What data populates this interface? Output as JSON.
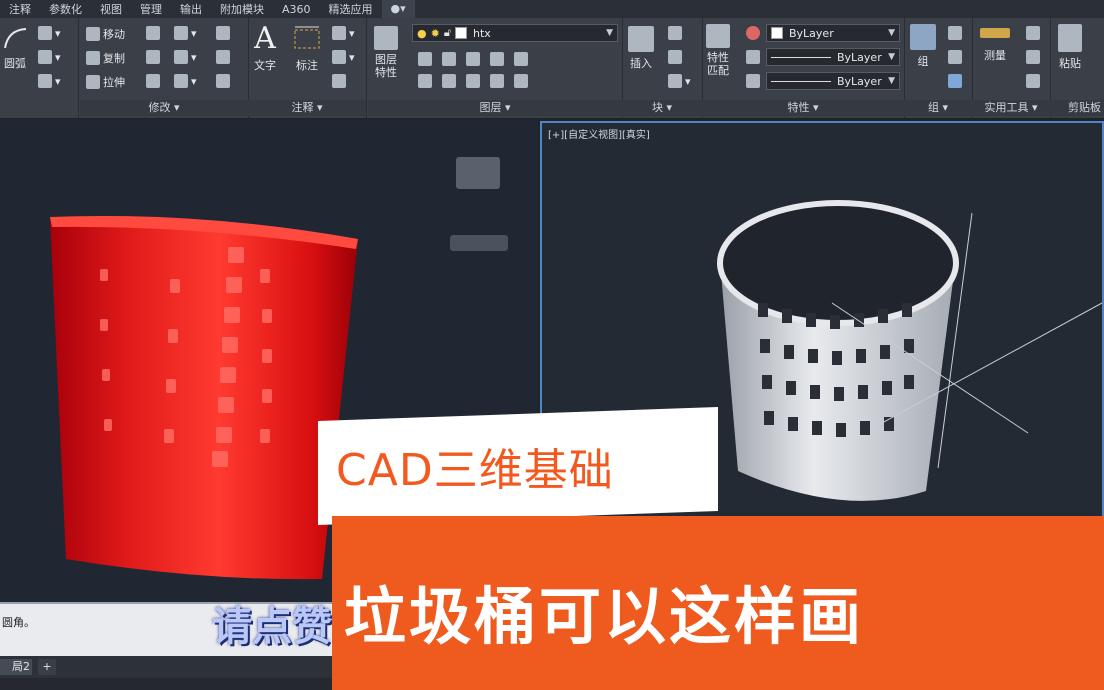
{
  "menu": [
    "注释",
    "参数化",
    "视图",
    "管理",
    "输出",
    "附加模块",
    "A360",
    "精选应用"
  ],
  "ribbon": {
    "draw": {
      "arc_label": "圆弧"
    },
    "modify": {
      "title": "修改",
      "move": "移动",
      "copy": "复制",
      "stretch": "拉伸"
    },
    "annotation": {
      "title": "注释",
      "text": "文字",
      "dim": "标注"
    },
    "layers": {
      "title": "图层",
      "props": "图层\n特性",
      "current_layer": "htx"
    },
    "block": {
      "title": "块",
      "insert": "插入"
    },
    "properties": {
      "title": "特性",
      "match": "特性\n匹配",
      "color": "ByLayer",
      "linetype": "ByLayer",
      "lineweight": "ByLayer"
    },
    "group": {
      "title": "组",
      "label": "组"
    },
    "utilities": {
      "title": "实用工具",
      "measure": "测量"
    },
    "clipboard": {
      "title": "剪贴板",
      "paste": "粘贴"
    }
  },
  "viewport": {
    "right_label": "[+][自定义视图][真实]"
  },
  "command_line": {
    "text": "圆角。"
  },
  "tabs": {
    "layout2": "局2",
    "add": "+"
  },
  "overlay": {
    "title": "CAD三维基础",
    "headline": "垃圾桶可以这样画",
    "subtitle": "请点赞"
  }
}
